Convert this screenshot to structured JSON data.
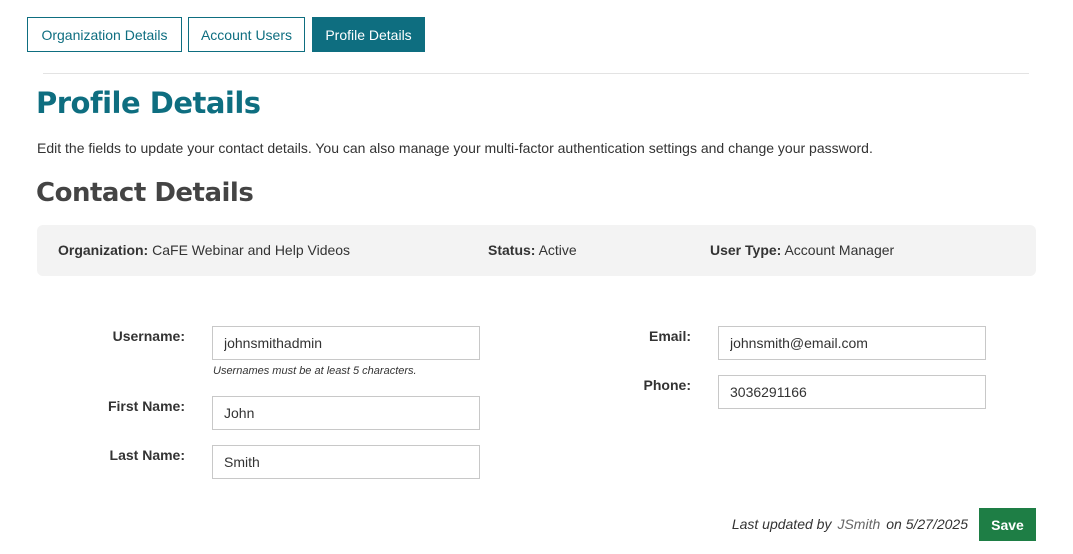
{
  "tabs": [
    {
      "label": "Organization Details",
      "active": false
    },
    {
      "label": "Account Users",
      "active": false
    },
    {
      "label": "Profile Details",
      "active": true
    }
  ],
  "page": {
    "title": "Profile Details",
    "intro": "Edit the fields to update your contact details. You can also manage your multi-factor authentication settings and change your password.",
    "section_title": "Contact Details"
  },
  "info": {
    "org_label": "Organization:",
    "org_value": "CaFE Webinar and Help Videos",
    "status_label": "Status:",
    "status_value": "Active",
    "type_label": "User Type:",
    "type_value": "Account Manager"
  },
  "form": {
    "username_label": "Username:",
    "username_value": "johnsmithadmin",
    "username_hint": "Usernames must be at least 5 characters.",
    "first_label": "First Name:",
    "first_value": "John",
    "last_label": "Last Name:",
    "last_value": "Smith",
    "email_label": "Email:",
    "email_value": "johnsmith@email.com",
    "phone_label": "Phone:",
    "phone_value": "3036291166"
  },
  "footer": {
    "updated_prefix": "Last updated by",
    "updated_user": "JSmith",
    "updated_suffix": "on 5/27/2025",
    "save_label": "Save"
  },
  "colors": {
    "accent": "#0e6e80",
    "save": "#1e7e45",
    "infobar_bg": "#f3f3f3"
  }
}
